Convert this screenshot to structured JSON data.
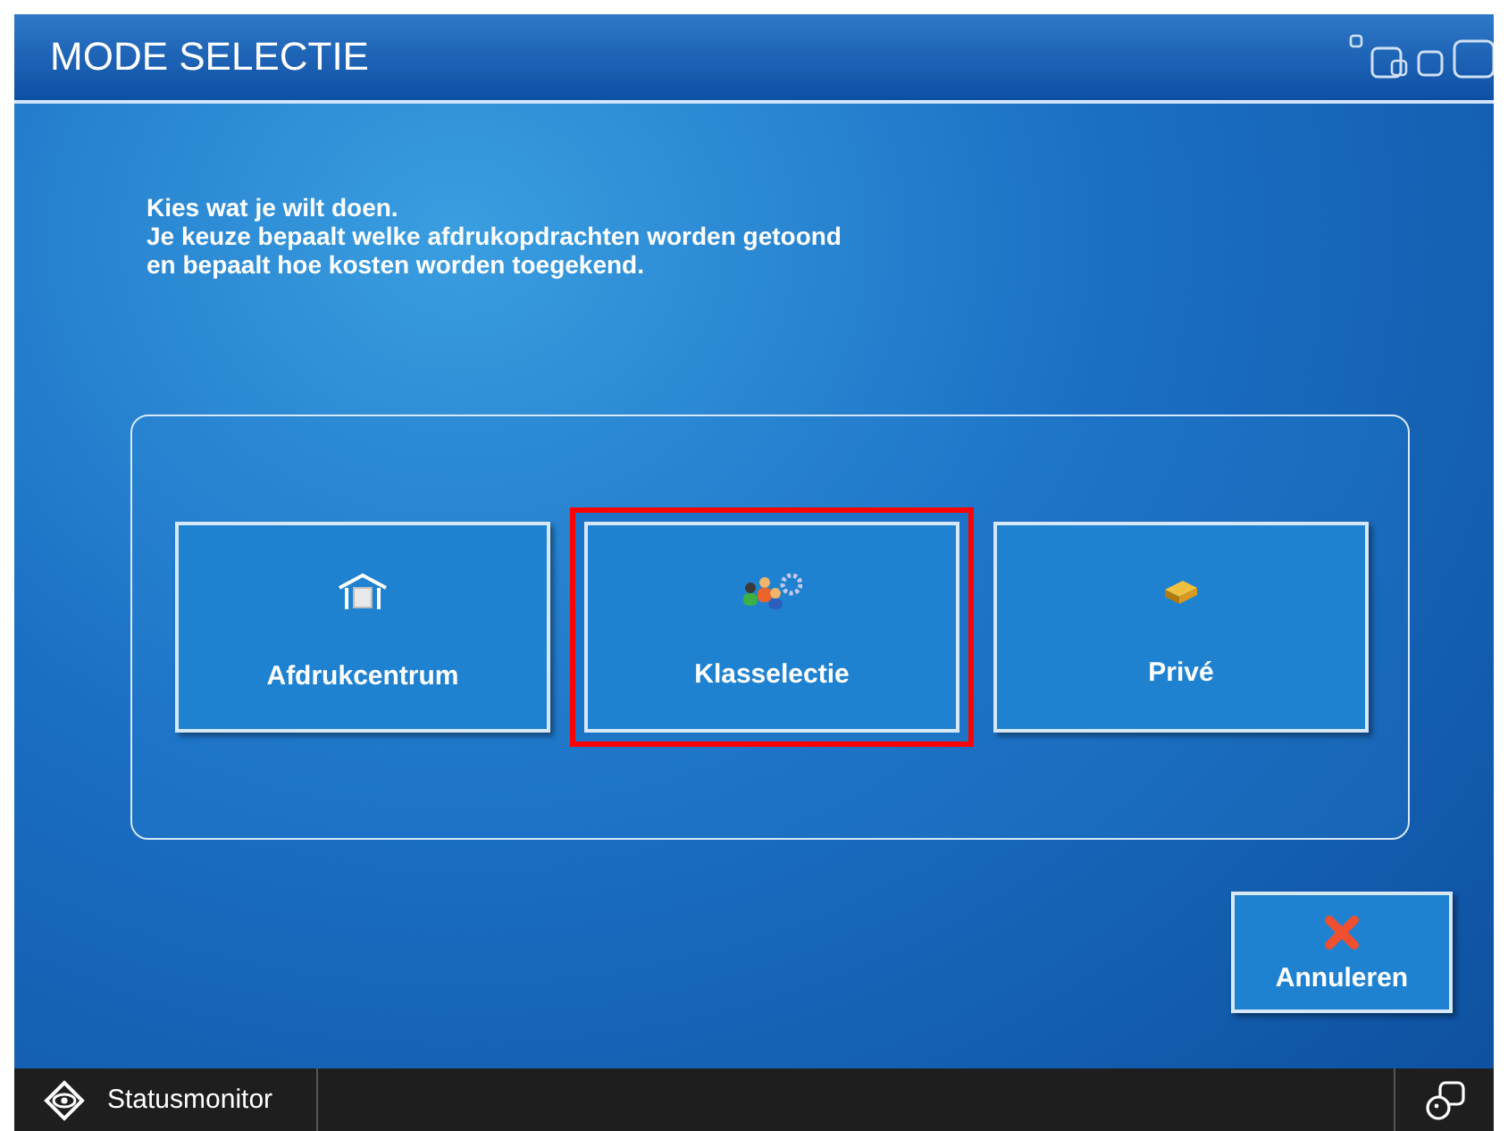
{
  "header": {
    "title": "MODE SELECTIE"
  },
  "instructions": [
    "Kies wat je wilt doen.",
    "Je keuze bepaalt welke afdrukopdrachten worden getoond",
    "en bepaalt hoe kosten worden toegekend."
  ],
  "options": [
    {
      "label": "Afdrukcentrum",
      "kind": "house",
      "selected": false
    },
    {
      "label": "Klasselectie",
      "kind": "group",
      "selected": true
    },
    {
      "label": "Privé",
      "kind": "box",
      "selected": false
    }
  ],
  "cancel_button": {
    "label": "Annuleren"
  },
  "status_bar": {
    "label": "Statusmonitor"
  }
}
